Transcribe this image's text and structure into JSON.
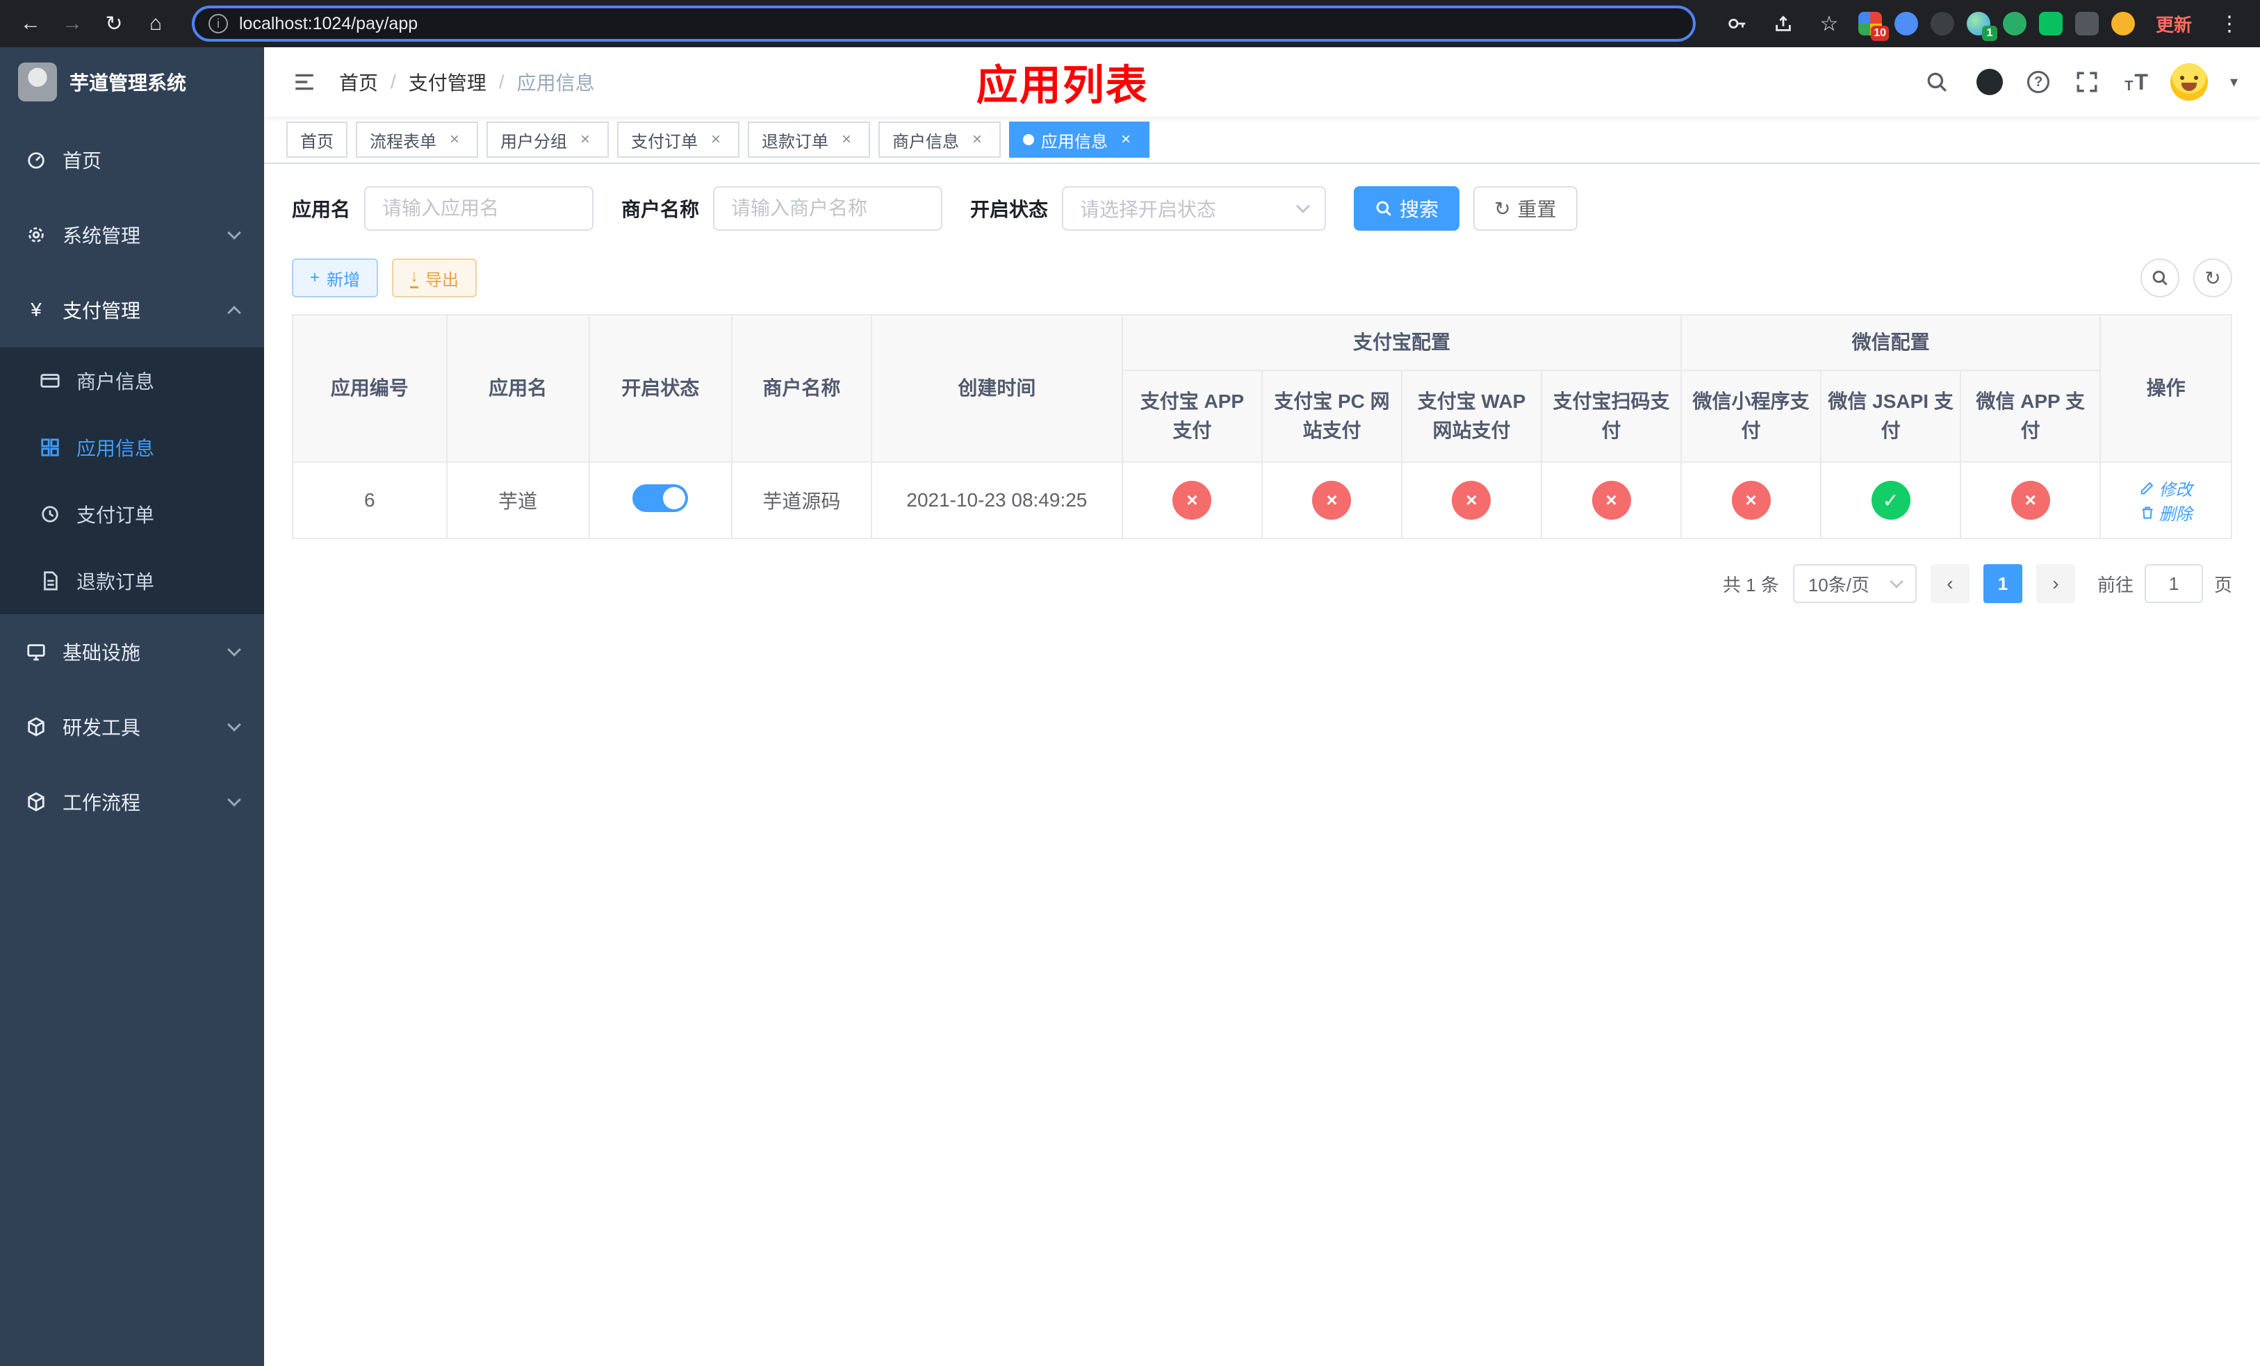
{
  "browser": {
    "url": "localhost:1024/pay/app",
    "update_button": "更新",
    "extension_badge_grid": "10",
    "extension_badge_translate": "1"
  },
  "icons": {
    "back": "←",
    "forward": "→",
    "reload": "↻",
    "home": "⌂",
    "star": "☆",
    "menu_kebab": "⋮",
    "info": "i",
    "close": "×",
    "cross": "×",
    "check": "✓",
    "plus": "+",
    "download": "↓",
    "refresh": "↻",
    "prev": "‹",
    "next": "›",
    "help": "?",
    "caret": "▾",
    "yen": "¥",
    "font": "T"
  },
  "sidebar": {
    "title": "芋道管理系统",
    "items": [
      {
        "label": "首页"
      },
      {
        "label": "系统管理"
      },
      {
        "label": "支付管理"
      },
      {
        "label": "基础设施"
      },
      {
        "label": "研发工具"
      },
      {
        "label": "工作流程"
      }
    ],
    "payment_children": [
      {
        "label": "商户信息"
      },
      {
        "label": "应用信息"
      },
      {
        "label": "支付订单"
      },
      {
        "label": "退款订单"
      }
    ]
  },
  "header": {
    "breadcrumb": [
      "首页",
      "支付管理",
      "应用信息"
    ],
    "overlay_title": "应用列表"
  },
  "tabs": [
    {
      "label": "首页"
    },
    {
      "label": "流程表单"
    },
    {
      "label": "用户分组"
    },
    {
      "label": "支付订单"
    },
    {
      "label": "退款订单"
    },
    {
      "label": "商户信息"
    },
    {
      "label": "应用信息"
    }
  ],
  "filters": {
    "app_name_label": "应用名",
    "app_name_placeholder": "请输入应用名",
    "merchant_label": "商户名称",
    "merchant_placeholder": "请输入商户名称",
    "status_label": "开启状态",
    "status_placeholder": "请选择开启状态",
    "search_button": "搜索",
    "reset_button": "重置"
  },
  "toolbar": {
    "add_button": "新增",
    "export_button": "导出"
  },
  "table": {
    "left_columns": [
      "应用编号",
      "应用名",
      "开启状态",
      "商户名称",
      "创建时间"
    ],
    "alipay_group": "支付宝配置",
    "wechat_group": "微信配置",
    "alipay_columns": [
      "支付宝 APP 支付",
      "支付宝 PC 网站支付",
      "支付宝 WAP 网站支付",
      "支付宝扫码支付"
    ],
    "wechat_columns": [
      "微信小程序支付",
      "微信 JSAPI 支付",
      "微信 APP 支付"
    ],
    "op_column": "操作",
    "row": {
      "id": "6",
      "name": "芋道",
      "enabled": true,
      "merchant": "芋道源码",
      "created_at": "2021-10-23 08:49:25",
      "alipay_app": "closed",
      "alipay_pc": "closed",
      "alipay_wap": "closed",
      "alipay_qr": "closed",
      "wechat_mini": "closed",
      "wechat_jsapi": "open",
      "wechat_app": "closed",
      "edit_label": "修改",
      "delete_label": "删除"
    }
  },
  "pagination": {
    "total": "共 1 条",
    "page_size": "10条/页",
    "page": "1",
    "goto_label": "前往",
    "goto_value": "1",
    "goto_unit": "页"
  },
  "colors": {
    "primary": "#409eff",
    "success": "#13ce66",
    "danger": "#f56c6c",
    "warning": "#e6a23c",
    "sidebar_bg": "#304156",
    "submenu_bg": "#1f2d3d",
    "overlay_title": "#ff0000"
  }
}
